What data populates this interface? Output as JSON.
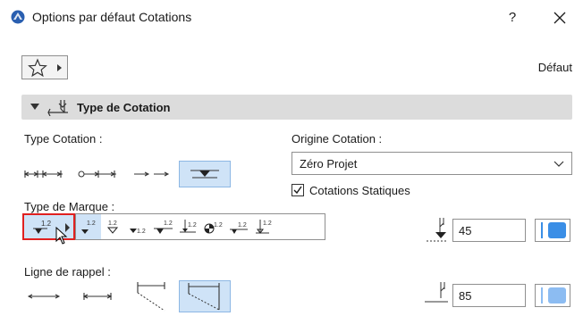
{
  "window": {
    "title": "Options par défaut Cotations",
    "help_label": "?",
    "close_label": "✕"
  },
  "toolbar": {
    "default_label": "Défaut",
    "favorites_icon": "star-icon"
  },
  "section": {
    "title": "Type de Cotation",
    "collapse_icon": "triangle-down-icon"
  },
  "labels": {
    "type_cotation": "Type Cotation :",
    "origine_cotation": "Origine Cotation :",
    "type_de_marque": "Type de Marque :",
    "ligne_de_rappel": "Ligne de rappel :",
    "cotations_statiques": "Cotations Statiques"
  },
  "origine": {
    "selected": "Zéro Projet"
  },
  "cotations_statiques_checked": true,
  "dimension_types": {
    "selected_index": 3,
    "count": 4
  },
  "marker": {
    "height_value": "45",
    "label": "1.2"
  },
  "extension": {
    "value": "85",
    "selected_index": 3
  },
  "colors": {
    "accent": "#cfe3f7",
    "pen_blue": "#3a8ee6",
    "pen_blue_light": "#8cbcf2",
    "selection_red": "#e02020"
  }
}
